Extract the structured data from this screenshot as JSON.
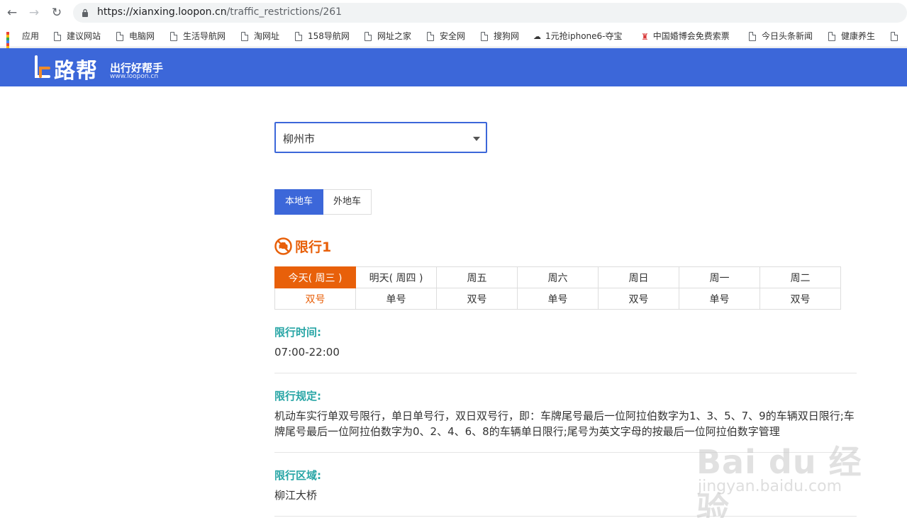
{
  "browser": {
    "url_host": "https://xianxing.loopon.cn",
    "url_path": "/traffic_restrictions/261",
    "bookmarks": [
      "应用",
      "建议网站",
      "电脑网",
      "生活导航网",
      "淘网址",
      "158导航网",
      "网址之家",
      "安全网",
      "搜狗网",
      "1元抢iphone6-夺宝",
      "中国婚博会免费索票",
      "今日头条新闻",
      "健康养生"
    ]
  },
  "site": {
    "logo_text": "路帮",
    "slogan": "出行好帮手",
    "site_url": "www.loopon.cn",
    "brand_color": "#3c67d9"
  },
  "city_select": {
    "value": "柳州市"
  },
  "tabs": [
    {
      "label": "本地车",
      "active": true
    },
    {
      "label": "外地车",
      "active": false
    }
  ],
  "restriction": {
    "icon": "no-car-icon",
    "title": "限行1",
    "accent_color": "#e8600a",
    "days": [
      "今天( 周三 )",
      "明天( 周四 )",
      "周五",
      "周六",
      "周日",
      "周一",
      "周二"
    ],
    "plates": [
      "双号",
      "单号",
      "双号",
      "单号",
      "双号",
      "单号",
      "双号"
    ]
  },
  "sections": {
    "time_label": "限行时间:",
    "time_value": "07:00-22:00",
    "rule_label": "限行规定:",
    "rule_value": "机动车实行单双号限行，单日单号行，双日双号行，即：车牌尾号最后一位阿拉伯数字为1、3、5、7、9的车辆双日限行;车牌尾号最后一位阿拉伯数字为0、2、4、6、8的车辆单日限行;尾号为英文字母的按最后一位阿拉伯数字管理",
    "area_label": "限行区域:",
    "area_value": "柳江大桥"
  },
  "watermark": {
    "main": "Bai du 经验",
    "sub": "jingyan.baidu.com"
  }
}
